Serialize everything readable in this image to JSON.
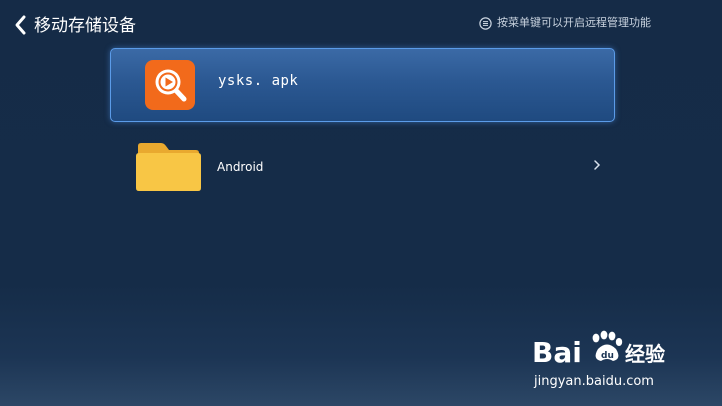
{
  "header": {
    "title": "移动存储设备",
    "hint": "按菜单键可以开启远程管理功能"
  },
  "files": [
    {
      "name": "ysks. apk",
      "type": "apk",
      "selected": true
    },
    {
      "name": "Android",
      "type": "folder",
      "selected": false
    }
  ],
  "watermark": {
    "logo_left": "Bai",
    "logo_right": "经验",
    "url": "jingyan.baidu.com"
  },
  "colors": {
    "background": "#152b47",
    "selection": "#2b5892",
    "apk_icon": "#f26a1b",
    "folder": "#f7c444"
  }
}
